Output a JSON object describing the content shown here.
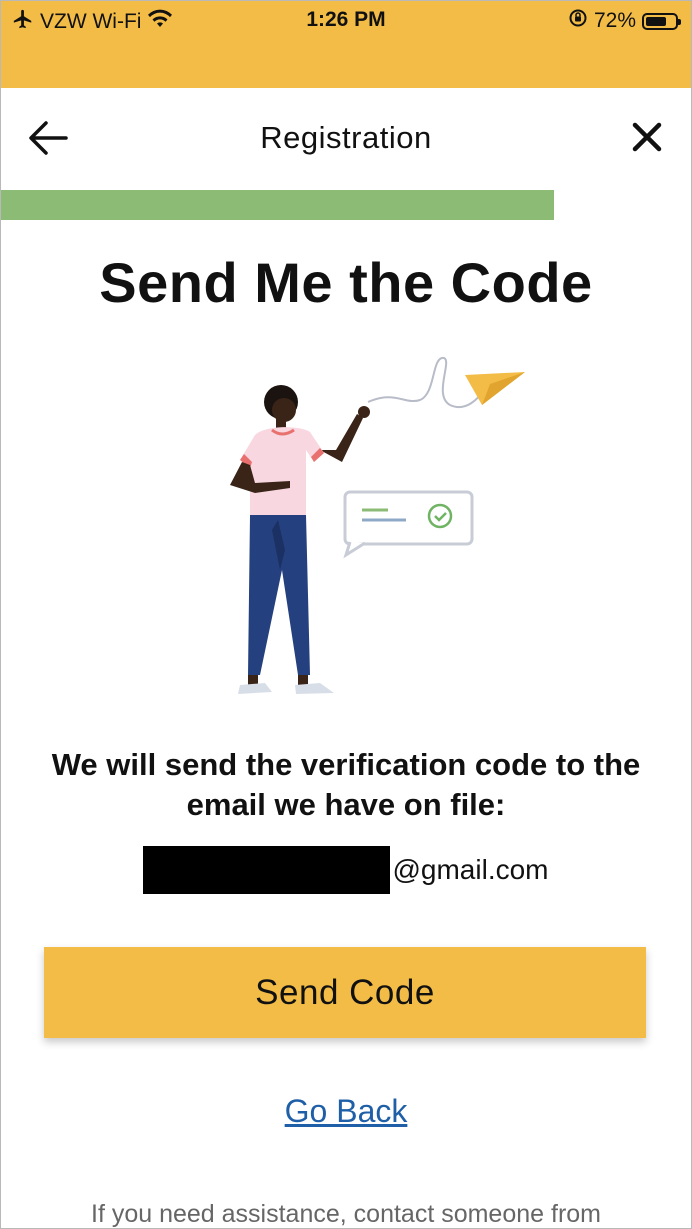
{
  "status_bar": {
    "carrier": "VZW Wi-Fi",
    "time": "1:26 PM",
    "battery": "72%",
    "battery_level": 0.72
  },
  "header": {
    "title": "Registration"
  },
  "progress": {
    "value": 0.8
  },
  "main": {
    "title": "Send Me the Code",
    "message": "We will send the verification code to the email we have on file:",
    "email_domain": "@gmail.com",
    "send_button": "Send Code",
    "go_back": "Go Back",
    "assistance": "If you need assistance, contact someone from"
  },
  "colors": {
    "accent": "#F2BC47",
    "progress": "#8BBB75",
    "link": "#1F5FA8"
  }
}
